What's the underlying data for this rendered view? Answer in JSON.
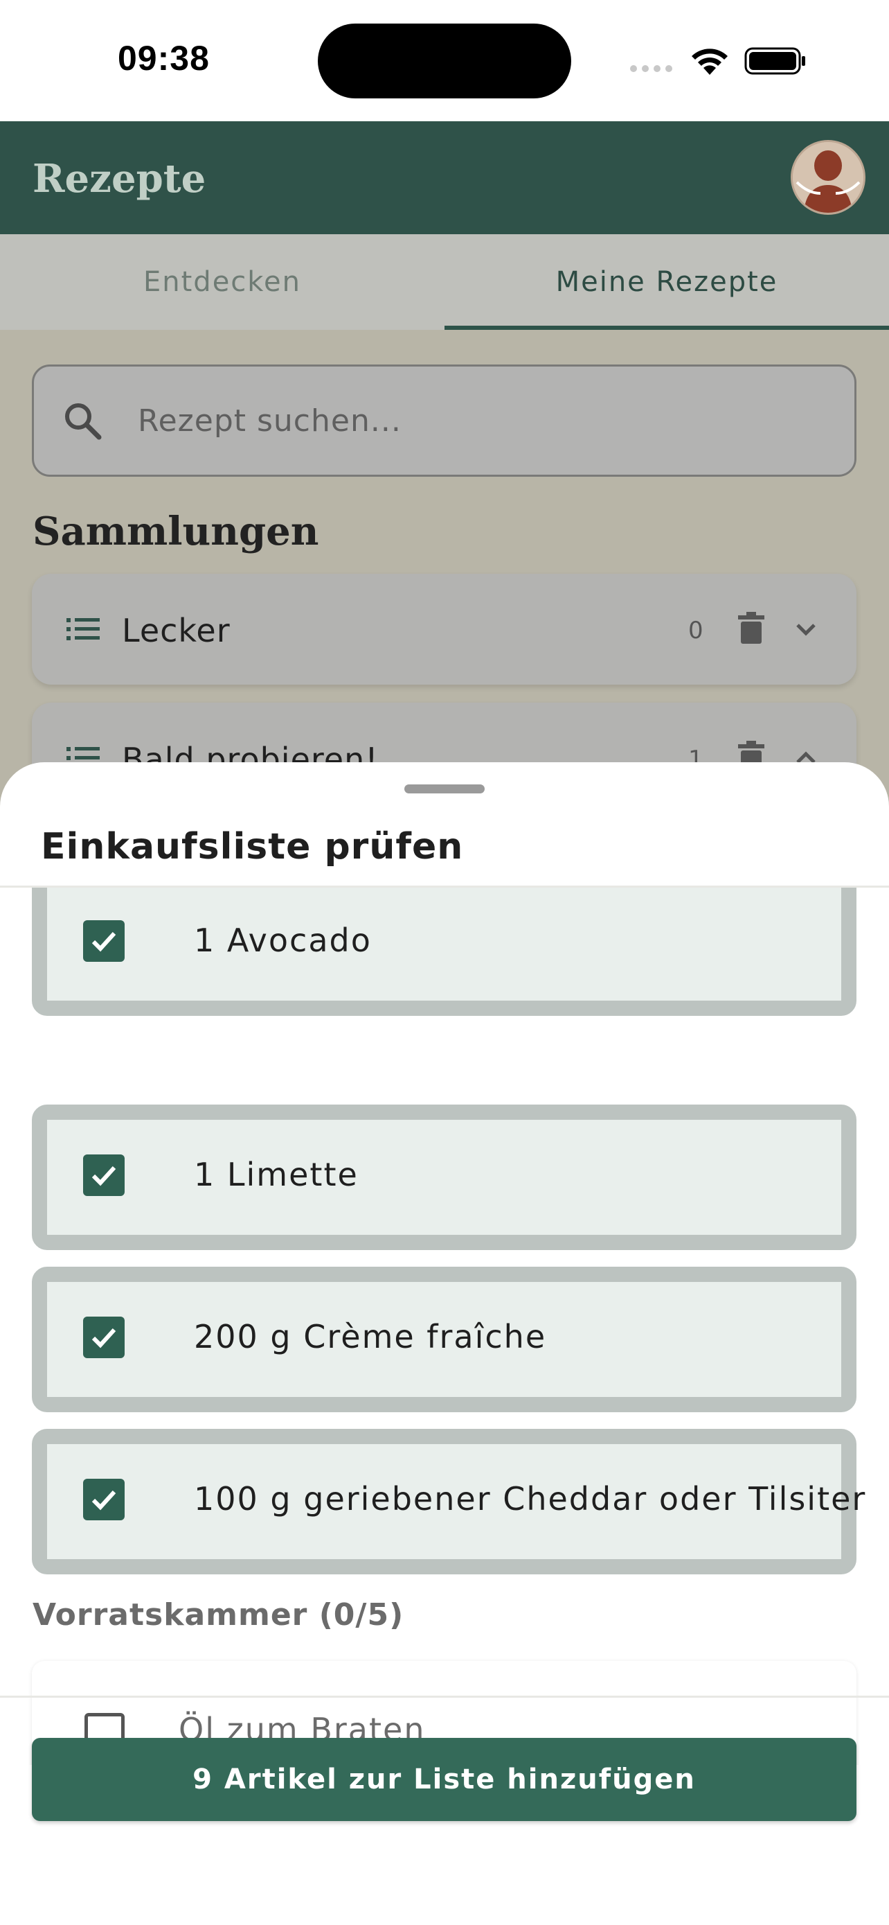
{
  "status_bar": {
    "time": "09:38"
  },
  "app": {
    "title": "Rezepte",
    "tabs": [
      {
        "label": "Entdecken",
        "selected": false
      },
      {
        "label": "Meine Rezepte",
        "selected": true
      }
    ],
    "search": {
      "placeholder": "Rezept suchen..."
    },
    "collections_heading": "Sammlungen",
    "collections": [
      {
        "name": "Lecker",
        "count": "0",
        "expanded": false
      },
      {
        "name": "Bald probieren!",
        "count": "1",
        "expanded": true
      }
    ]
  },
  "sheet": {
    "title": "Einkaufsliste prüfen",
    "items": [
      {
        "text": "1 Avocado",
        "checked": true
      },
      {
        "text": "1 Limette",
        "checked": true
      },
      {
        "text": "200 g Crème fraîche",
        "checked": true
      },
      {
        "text": "100 g geriebener Cheddar oder Tilsiter",
        "checked": true
      }
    ],
    "pantry_heading": "Vorratskammer (0/5)",
    "pantry_items": [
      {
        "text": "Öl zum Braten",
        "checked": false
      }
    ],
    "add_button_label": "9 Artikel zur Liste hinzufügen"
  },
  "colors": {
    "app_bar": "#2f5249",
    "accent": "#346a59",
    "checkbox": "#2f6152",
    "item_background": "#e9efec",
    "item_border": "#bcc3c0"
  }
}
